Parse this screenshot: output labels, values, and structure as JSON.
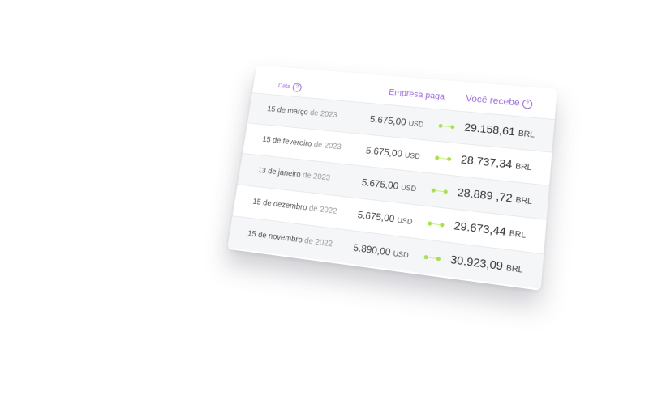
{
  "table": {
    "headers": {
      "date": "Data",
      "company_pays": "Empresa paga",
      "you_receive": "Você recebe",
      "help_glyph": "?"
    },
    "rows": [
      {
        "date_main": "15 de março",
        "date_year": " de 2023",
        "pays": "5.675,00",
        "pays_currency": "USD",
        "receives": "29.158,61",
        "receives_currency": "BRL"
      },
      {
        "date_main": "15 de fevereiro",
        "date_year": " de 2023",
        "pays": "5.675,00",
        "pays_currency": "USD",
        "receives": "28.737,34",
        "receives_currency": "BRL"
      },
      {
        "date_main": "13 de janeiro",
        "date_year": " de 2023",
        "pays": "5.675,00",
        "pays_currency": "USD",
        "receives": "28.889 ,72",
        "receives_currency": "BRL"
      },
      {
        "date_main": "15 de dezembro",
        "date_year": " de 2022",
        "pays": "5.675,00",
        "pays_currency": "USD",
        "receives": "29.673,44",
        "receives_currency": "BRL"
      },
      {
        "date_main": "15 de novembro",
        "date_year": " de 2022",
        "pays": "5.890,00",
        "pays_currency": "USD",
        "receives": "30.923,09",
        "receives_currency": "BRL"
      }
    ]
  },
  "colors": {
    "header_text": "#9b6bdc",
    "connector": "#a8e04f"
  }
}
